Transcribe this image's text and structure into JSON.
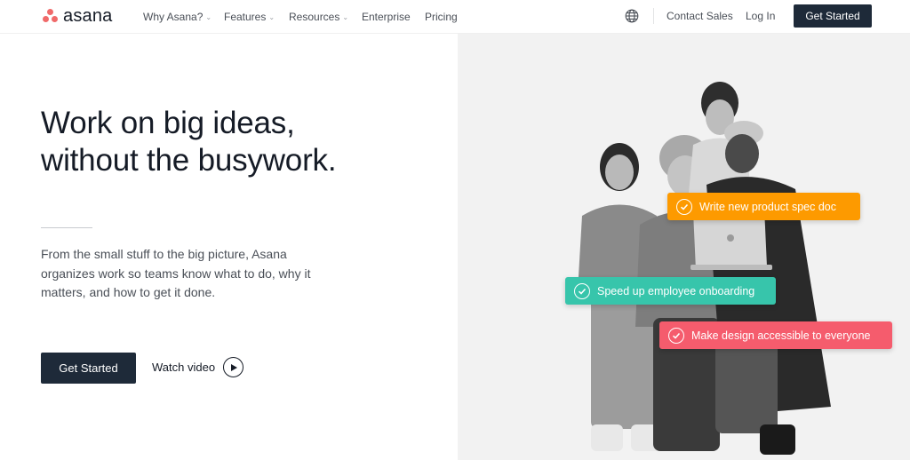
{
  "brand": {
    "name": "asana",
    "logo_color": "#f06a6a"
  },
  "nav": {
    "links": [
      {
        "label": "Why Asana?",
        "has_dropdown": true
      },
      {
        "label": "Features",
        "has_dropdown": true
      },
      {
        "label": "Resources",
        "has_dropdown": true
      },
      {
        "label": "Enterprise",
        "has_dropdown": false
      },
      {
        "label": "Pricing",
        "has_dropdown": false
      }
    ],
    "globe_icon": "globe-icon",
    "contact_sales": "Contact Sales",
    "login": "Log In",
    "cta": "Get Started"
  },
  "hero": {
    "title_line1": "Work on big ideas,",
    "title_line2": "without the busywork.",
    "subtitle": "From the small stuff to the big picture, Asana organizes work so teams know what to do, why it matters, and how to get it done.",
    "cta": "Get Started",
    "watch_video": "Watch video"
  },
  "tasks": [
    {
      "label": "Write new product spec doc",
      "color": "#fd9a00"
    },
    {
      "label": "Speed up employee onboarding",
      "color": "#37c5ab"
    },
    {
      "label": "Make design accessible to everyone",
      "color": "#f55c6d"
    }
  ],
  "colors": {
    "primary_dark": "#1e2a39",
    "text": "#151b26",
    "muted": "#4a4f57",
    "photo_bg": "#f2f2f2"
  }
}
